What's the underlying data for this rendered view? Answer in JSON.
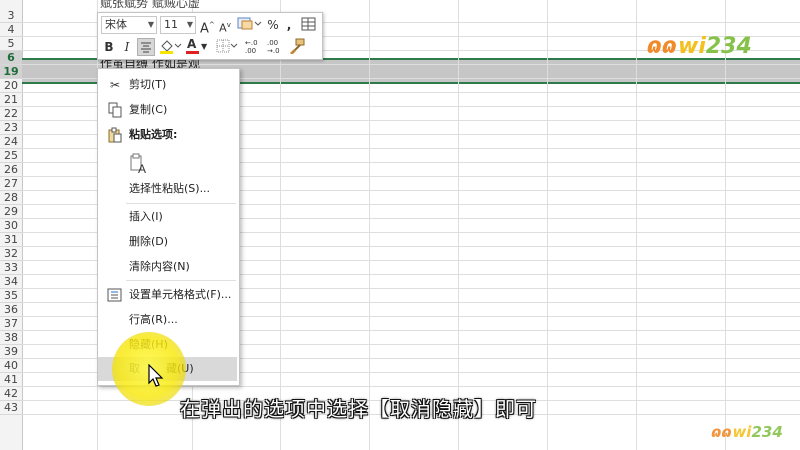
{
  "sheet": {
    "row_numbers": [
      "3",
      "4",
      "5",
      "6",
      "19",
      "20",
      "21",
      "22",
      "23",
      "24",
      "25",
      "26",
      "27",
      "28",
      "29",
      "30",
      "31",
      "32",
      "33",
      "34",
      "35",
      "36",
      "37",
      "38",
      "39",
      "40",
      "41",
      "42",
      "43"
    ],
    "selected_rows": [
      "6",
      "19"
    ],
    "partial_top_text": "赋张赋势  赋贼心虚",
    "cell_text_row6": "作茧自缚  作如是观"
  },
  "mini_toolbar": {
    "font_name": "宋体",
    "font_size": "11",
    "grow_font": "A",
    "shrink_font": "A",
    "percent": "%",
    "comma": ",",
    "bold": "B",
    "italic": "I",
    "font_color_letter": "A",
    "increase_decimal": "←.0\n.00",
    "decrease_decimal": ".00\n→.0"
  },
  "context_menu": {
    "cut": "剪切(T)",
    "copy": "复制(C)",
    "paste_options": "粘贴选项:",
    "paste_special": "选择性粘贴(S)...",
    "insert": "插入(I)",
    "delete": "删除(D)",
    "clear_contents": "清除内容(N)",
    "format_cells": "设置单元格格式(F)...",
    "row_height": "行高(R)...",
    "hide": "隐藏(H)",
    "unhide_a": "取",
    "unhide_b": "藏(U)"
  },
  "caption": "在弹出的选项中选择【取消隐藏】即可",
  "watermark": {
    "p1": "ɷɷ",
    "p2": "wi",
    "p3": "234"
  },
  "colors": {
    "accent": "#2f7a4a",
    "highlight": "#f8e60a"
  }
}
